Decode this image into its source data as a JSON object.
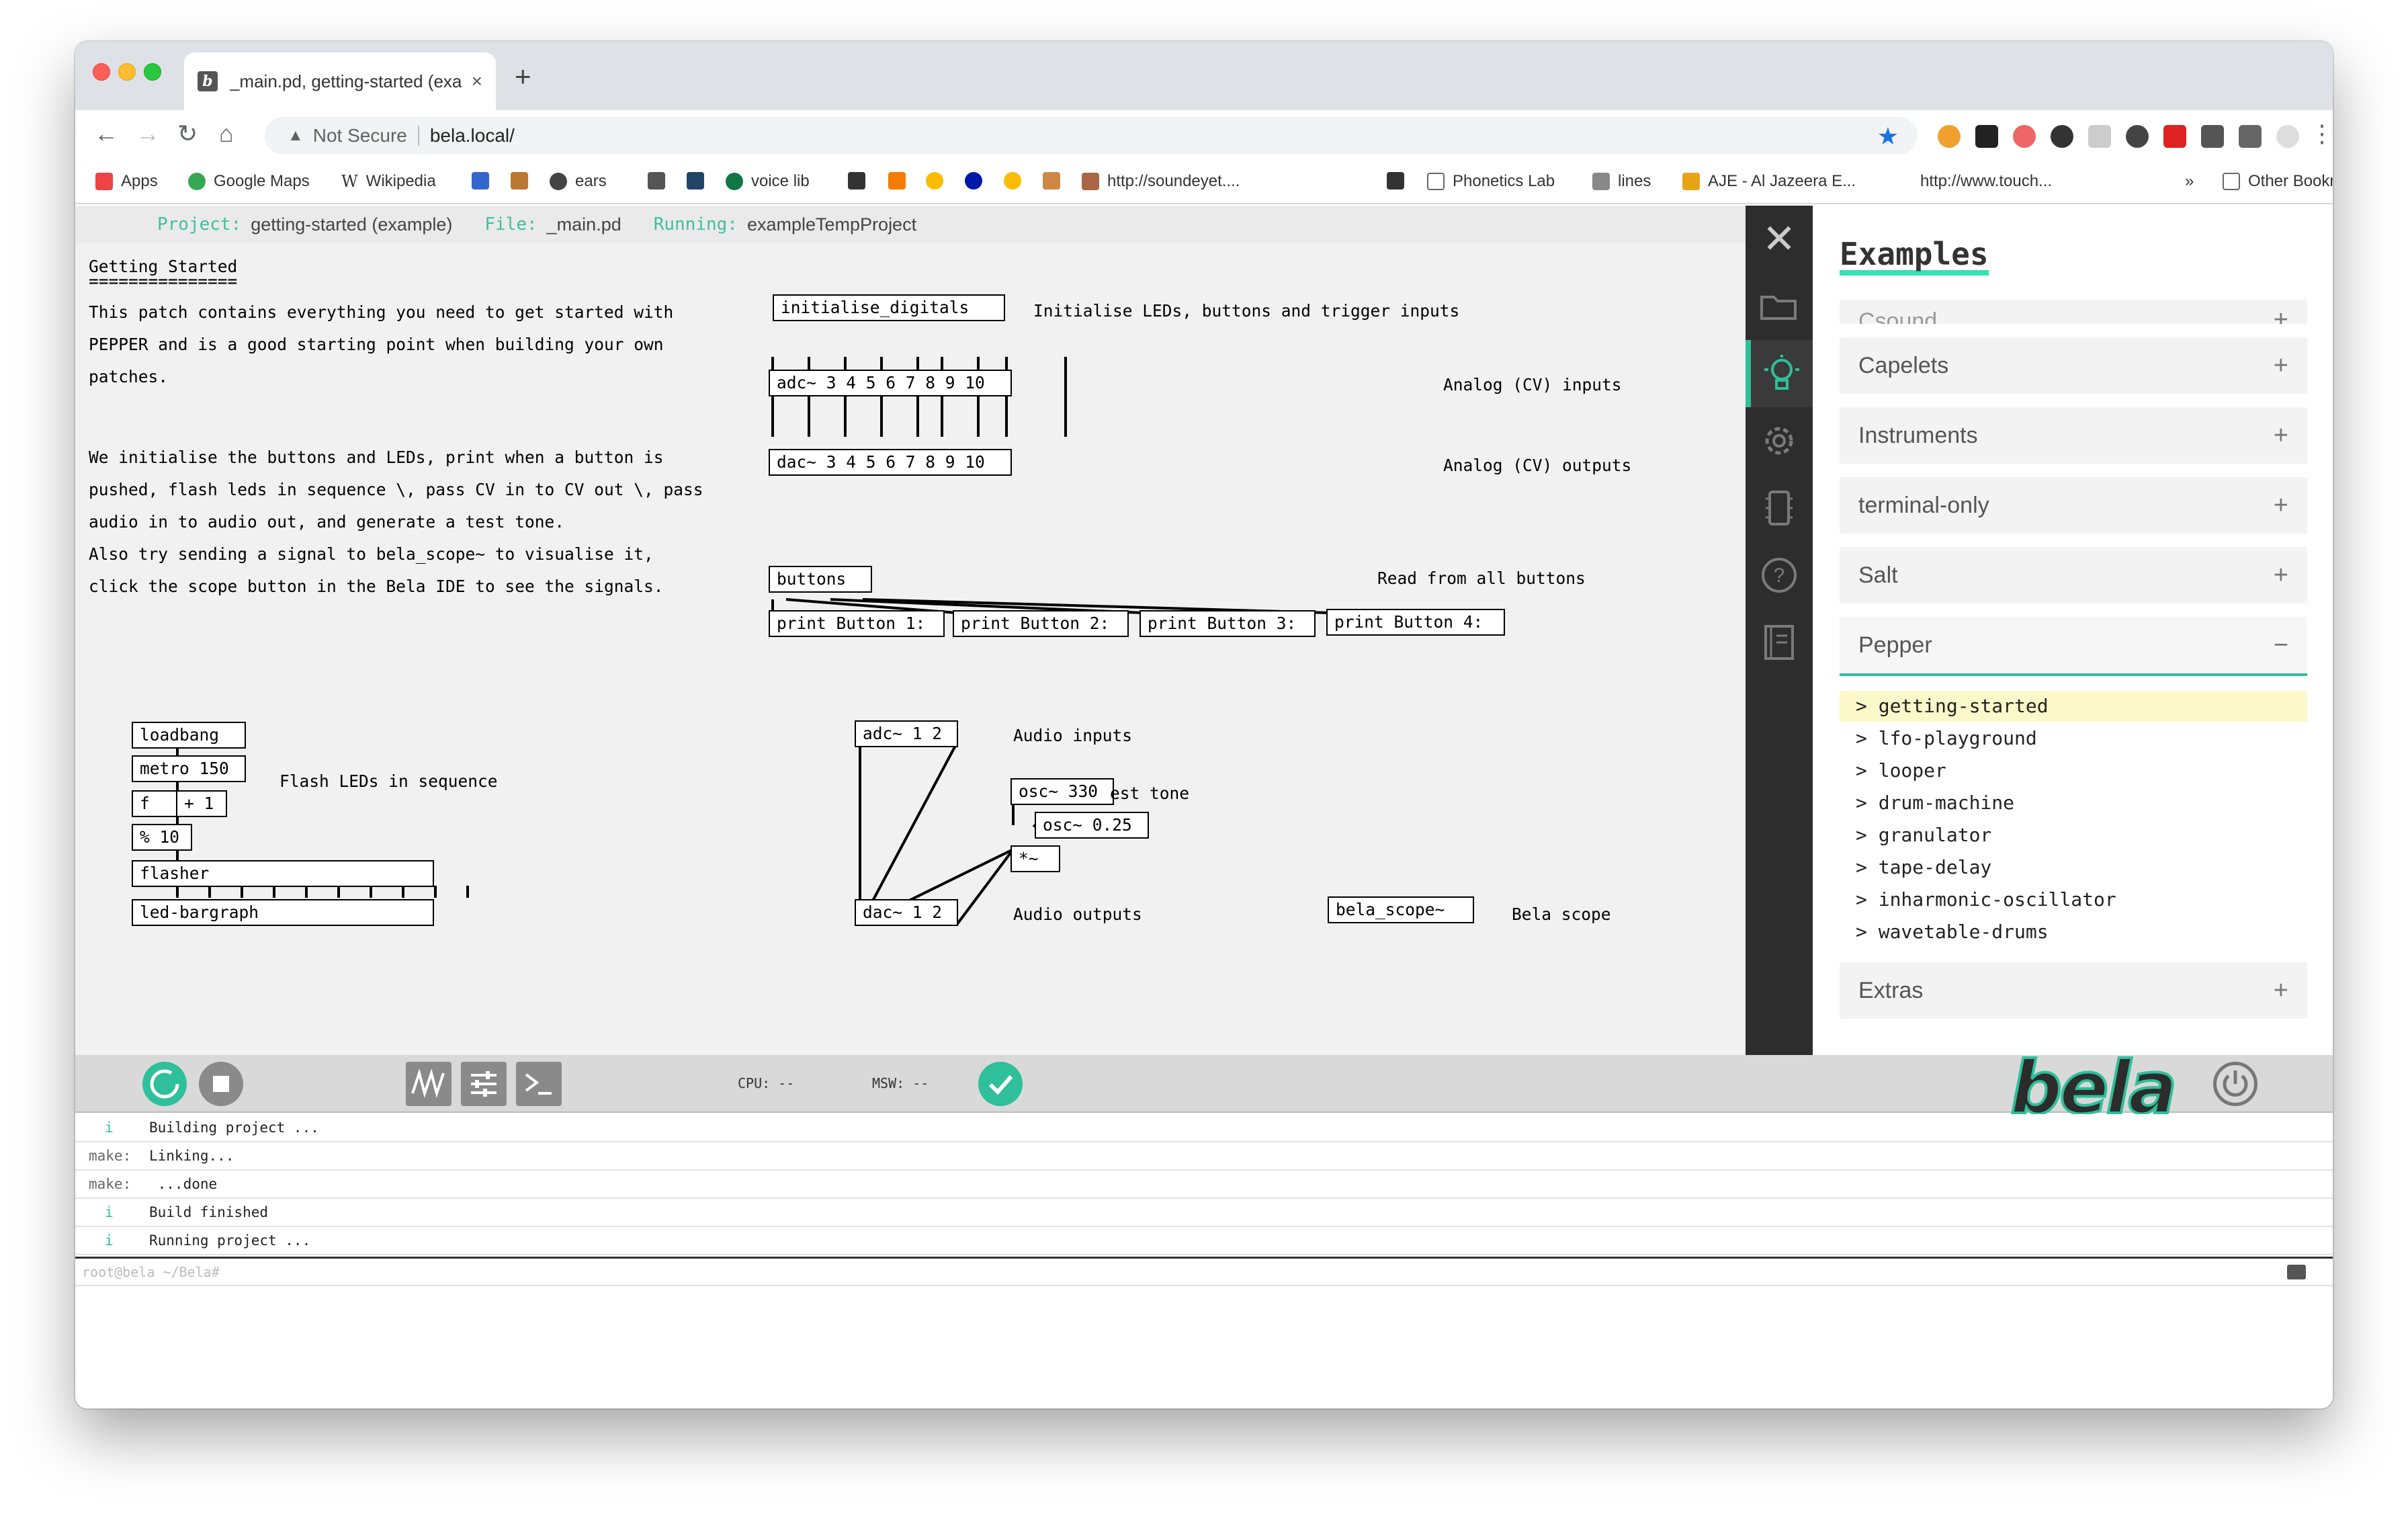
{
  "browser": {
    "tab_title": "_main.pd, getting-started (exa",
    "tab_close": "×",
    "new_tab": "+",
    "favicon_letter": "b",
    "security_label": "Not Secure",
    "url": "bela.local/",
    "back": "←",
    "forward": "→",
    "reload": "↻",
    "home": "⌂",
    "star": "★",
    "menu": "⋮",
    "warning": "▲"
  },
  "bookmarks": {
    "apps": "Apps",
    "google_maps": "Google Maps",
    "wikipedia": "Wikipedia",
    "wikipedia_glyph": "W",
    "ears": "ears",
    "voice_lib": "voice lib",
    "soundeye": "http://soundeyet....",
    "phonetics_lab": "Phonetics Lab",
    "lines": "lines",
    "aljazeera": "AJE - Al Jazeera E...",
    "touch": "http://www.touch...",
    "more": "»",
    "other": "Other Bookmarks"
  },
  "infobar": {
    "project_key": "Project:",
    "project_val": "getting-started (example)",
    "file_key": "File:",
    "file_val": "_main.pd",
    "running_key": "Running:",
    "running_val": "exampleTempProject"
  },
  "patch": {
    "intro_title": "Getting Started",
    "intro_underline": "===============",
    "intro_lines": [
      "This patch contains everything you need to get started with",
      "PEPPER and is a good starting point when building your own",
      "patches."
    ],
    "desc_lines": [
      "We initialise the buttons and LEDs, print when a button is",
      "pushed, flash leds in sequence \\, pass CV in to CV out \\, pass",
      "audio in to audio out, and generate a test tone.",
      "Also try sending a signal to bela_scope~ to visualise it,",
      "click the scope button in the Bela IDE to see the signals."
    ],
    "boxes": {
      "initialise_digitals": "initialise_digitals",
      "adc_cv": "adc~ 3 4 5 6 7 8 9 10",
      "dac_cv": "dac~ 3 4 5 6 7 8 9 10",
      "buttons": "buttons",
      "print1": "print Button 1:",
      "print2": "print Button 2:",
      "print3": "print Button 3:",
      "print4": "print Button 4:",
      "loadbang": "loadbang",
      "metro": "metro 150",
      "f": "f",
      "plus1": "+ 1",
      "mod10": "% 10",
      "flasher": "flasher",
      "led_bargraph": "led-bargraph",
      "adc_audio": "adc~ 1 2",
      "dac_audio": "dac~ 1 2",
      "osc330": "osc~ 330",
      "osc025": "osc~ 0.25",
      "mult": "*~",
      "bela_scope": "bela_scope~"
    },
    "comments": {
      "init_leds": "Initialise LEDs, buttons and trigger inputs",
      "analog_in": "Analog (CV) inputs",
      "analog_out": "Analog (CV) outputs",
      "read_buttons": "Read from all buttons",
      "flash_leds": "Flash LEDs in sequence",
      "audio_inputs": "Audio inputs",
      "test_tone": "est tone",
      "audio_outputs": "Audio outputs",
      "bela_scope": "Bela scope"
    }
  },
  "examples": {
    "title": "Examples",
    "sections": [
      {
        "label": "Csound",
        "sign": "+"
      },
      {
        "label": "Capelets",
        "sign": "+"
      },
      {
        "label": "Instruments",
        "sign": "+"
      },
      {
        "label": "terminal-only",
        "sign": "+"
      },
      {
        "label": "Salt",
        "sign": "+"
      },
      {
        "label": "Pepper",
        "sign": "−"
      },
      {
        "label": "Extras",
        "sign": "+"
      }
    ],
    "pepper_items": [
      "> getting-started",
      "> lfo-playground",
      "> looper",
      "> drum-machine",
      "> granulator",
      "> tape-delay",
      "> inharmonic-oscillator",
      "> wavetable-drums"
    ]
  },
  "toolbar": {
    "cpu": "CPU: --",
    "msw": "MSW: --",
    "logo": "bela"
  },
  "console": {
    "lines": [
      {
        "tag": "i",
        "text": "Building project ..."
      },
      {
        "tag": "make:",
        "text": "Linking..."
      },
      {
        "tag": "make:",
        "text": " ...done"
      },
      {
        "tag": "i",
        "text": "Build finished"
      },
      {
        "tag": "i",
        "text": "Running project ..."
      }
    ],
    "prompt": "root@bela ~/Bela#"
  },
  "colors": {
    "accent": "#2fbf9a",
    "highlight": "#fbf8c9"
  }
}
